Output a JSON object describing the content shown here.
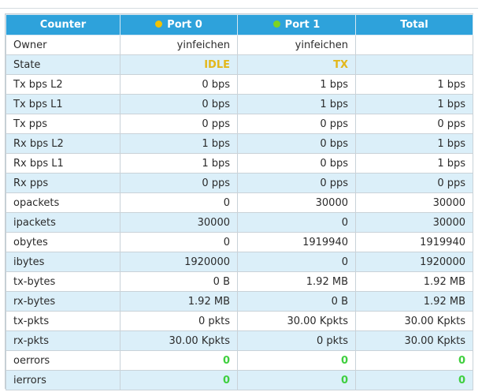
{
  "columns": {
    "counter": "Counter",
    "port0": "Port 0",
    "port1": "Port 1",
    "total": "Total"
  },
  "colors": {
    "header_bg": "#2ea2db",
    "port0_dot": "#f2c200",
    "port1_dot": "#7ed321",
    "state_text": "#e3b71a",
    "error_zero_text": "#3fcf3f",
    "row_alt_bg": "#dbeff9"
  },
  "icons": {
    "port0": "port0-status-dot-icon",
    "port1": "port1-status-dot-icon"
  },
  "rows": [
    {
      "label": "Owner",
      "port0": "yinfeichen",
      "port1": "yinfeichen",
      "total": ""
    },
    {
      "label": "State",
      "port0": "IDLE",
      "port1": "TX",
      "total": ""
    },
    {
      "label": "Tx bps L2",
      "port0": "0 bps",
      "port1": "1 bps",
      "total": "1 bps"
    },
    {
      "label": "Tx bps L1",
      "port0": "0 bps",
      "port1": "1 bps",
      "total": "1 bps"
    },
    {
      "label": "Tx pps",
      "port0": "0 pps",
      "port1": "0 pps",
      "total": "0 pps"
    },
    {
      "label": "Rx bps L2",
      "port0": "1 bps",
      "port1": "0 bps",
      "total": "1 bps"
    },
    {
      "label": "Rx bps L1",
      "port0": "1 bps",
      "port1": "0 bps",
      "total": "1 bps"
    },
    {
      "label": "Rx pps",
      "port0": "0 pps",
      "port1": "0 pps",
      "total": "0 pps"
    },
    {
      "label": "opackets",
      "port0": "0",
      "port1": "30000",
      "total": "30000"
    },
    {
      "label": "ipackets",
      "port0": "30000",
      "port1": "0",
      "total": "30000"
    },
    {
      "label": "obytes",
      "port0": "0",
      "port1": "1919940",
      "total": "1919940"
    },
    {
      "label": "ibytes",
      "port0": "1920000",
      "port1": "0",
      "total": "1920000"
    },
    {
      "label": "tx-bytes",
      "port0": "0 B",
      "port1": "1.92 MB",
      "total": "1.92 MB"
    },
    {
      "label": "rx-bytes",
      "port0": "1.92 MB",
      "port1": "0 B",
      "total": "1.92 MB"
    },
    {
      "label": "tx-pkts",
      "port0": "0 pkts",
      "port1": "30.00 Kpkts",
      "total": "30.00 Kpkts"
    },
    {
      "label": "rx-pkts",
      "port0": "30.00 Kpkts",
      "port1": "0 pkts",
      "total": "30.00 Kpkts"
    },
    {
      "label": "oerrors",
      "port0": "0",
      "port1": "0",
      "total": "0"
    },
    {
      "label": "ierrors",
      "port0": "0",
      "port1": "0",
      "total": "0"
    }
  ]
}
